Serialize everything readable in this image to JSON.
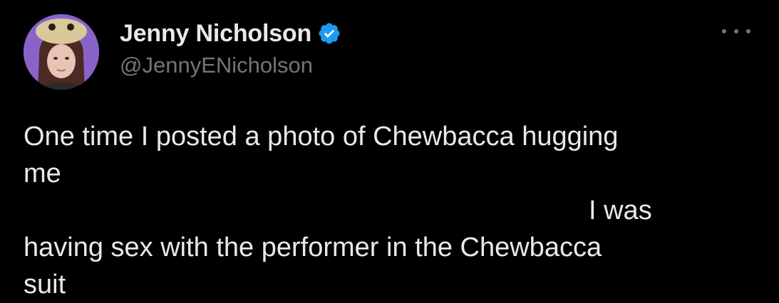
{
  "author": {
    "display_name": "Jenny Nicholson",
    "handle": "@JennyENicholson",
    "verified": true,
    "verified_icon": "verified-badge-icon",
    "avatar_icon": "avatar-photo"
  },
  "menu": {
    "icon": "more-options-icon"
  },
  "tweet": {
    "line1": "One time I posted a photo of Chewbacca hugging",
    "line2": "me",
    "line3": "I was",
    "line4": "having sex with the performer in the Chewbacca",
    "line5": "suit"
  },
  "colors": {
    "background": "#000000",
    "text": "#e7e9ea",
    "secondary_text": "#71767b",
    "verified_blue": "#1d9bf0",
    "avatar_bg": "#8a63c9"
  }
}
